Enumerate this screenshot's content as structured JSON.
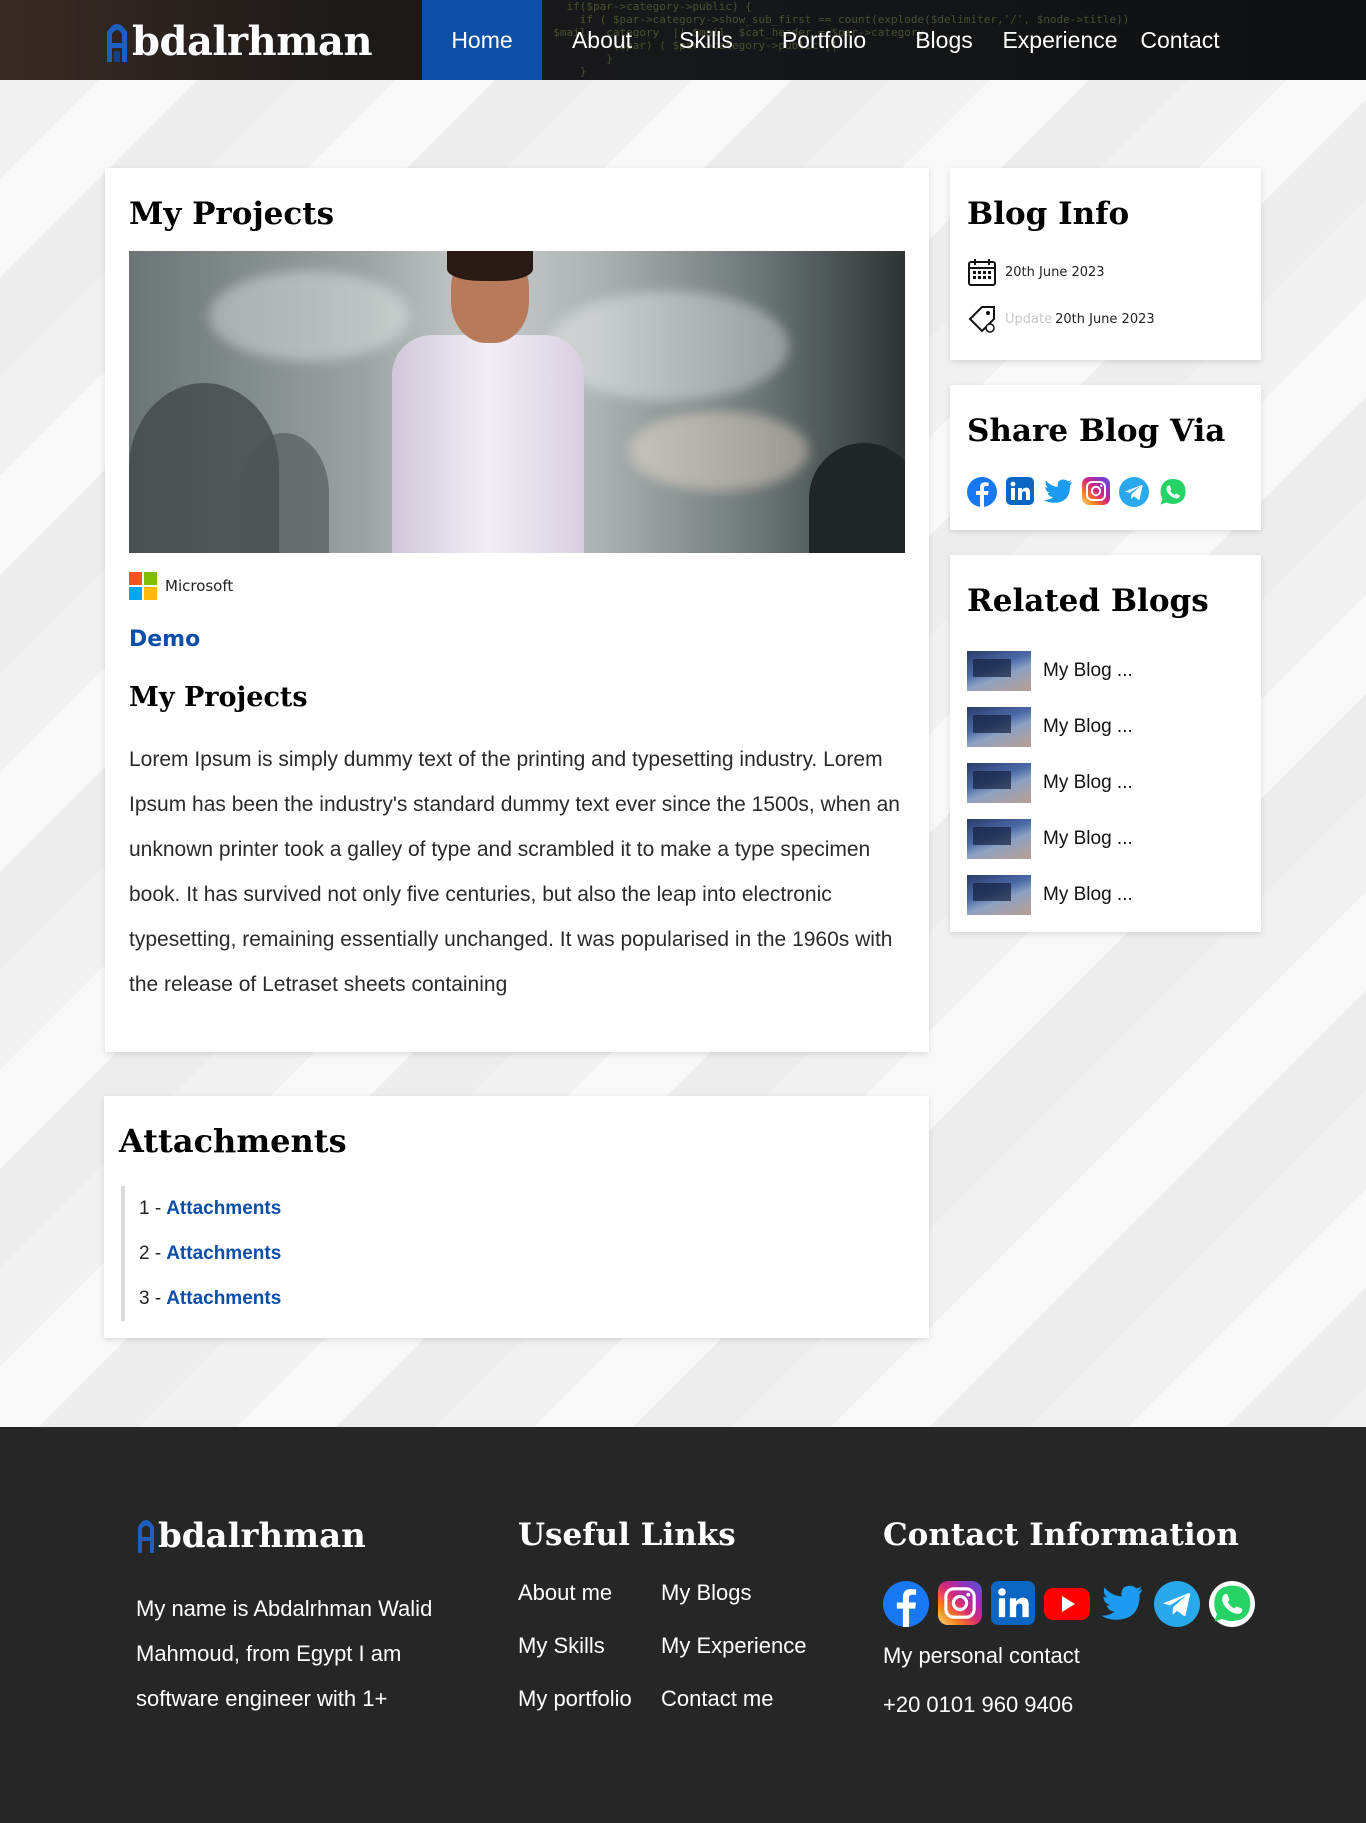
{
  "header": {
    "logo_text": "bdalrhman",
    "nav": [
      {
        "label": "Home",
        "active": true
      },
      {
        "label": "About",
        "active": false
      },
      {
        "label": "Skills",
        "active": false
      },
      {
        "label": "Portfolio",
        "active": false
      },
      {
        "label": "Blogs",
        "active": false
      },
      {
        "label": "Experience",
        "active": false
      },
      {
        "label": "Contact",
        "active": false
      }
    ]
  },
  "main": {
    "title": "My Projects",
    "company": "Microsoft",
    "demo_label": "Demo",
    "subtitle": "My Projects",
    "body": "Lorem Ipsum is simply dummy text of the printing and typesetting industry. Lorem Ipsum has been the industry's standard dummy text ever since the 1500s, when an unknown printer took a galley of type and scrambled it to make a type specimen book. It has survived not only five centuries, but also the leap into electronic typesetting, remaining essentially unchanged. It was popularised in the 1960s with the release of Letraset sheets containing"
  },
  "attachments": {
    "title": "Attachments",
    "items": [
      {
        "num": "1 -",
        "label": "Attachments"
      },
      {
        "num": "2 -",
        "label": "Attachments"
      },
      {
        "num": "3 -",
        "label": "Attachments"
      }
    ]
  },
  "blog_info": {
    "title": "Blog Info",
    "created": "20th June 2023",
    "update_label": "Update",
    "updated": "20th June 2023"
  },
  "share": {
    "title": "Share Blog Via",
    "icons": [
      "facebook-icon",
      "linkedin-icon",
      "twitter-icon",
      "instagram-icon",
      "telegram-icon",
      "whatsapp-icon"
    ]
  },
  "related": {
    "title": "Related Blogs",
    "items": [
      {
        "label": "My Blog ..."
      },
      {
        "label": "My Blog ..."
      },
      {
        "label": "My Blog ..."
      },
      {
        "label": "My Blog ..."
      },
      {
        "label": "My Blog ..."
      }
    ]
  },
  "footer": {
    "logo_text": "bdalrhman",
    "about": "My name is  Abdalrhman Walid Mahmoud, from Egypt I am software engineer with 1+",
    "links_title": "Useful Links",
    "links": [
      "About me",
      "My Blogs",
      "My Skills",
      "My Experience",
      "My portfolio",
      "Contact me"
    ],
    "contact_title": "Contact Information",
    "contact_label": "My personal contact",
    "phone": "+20 0101 960 9406",
    "social": [
      "facebook-icon",
      "instagram-icon",
      "linkedin-icon",
      "youtube-icon",
      "twitter-icon",
      "telegram-icon",
      "whatsapp-icon"
    ]
  },
  "colors": {
    "accent": "#0d4ea6",
    "footer_bg": "#262626",
    "page_bg": "#f3f3f3"
  }
}
